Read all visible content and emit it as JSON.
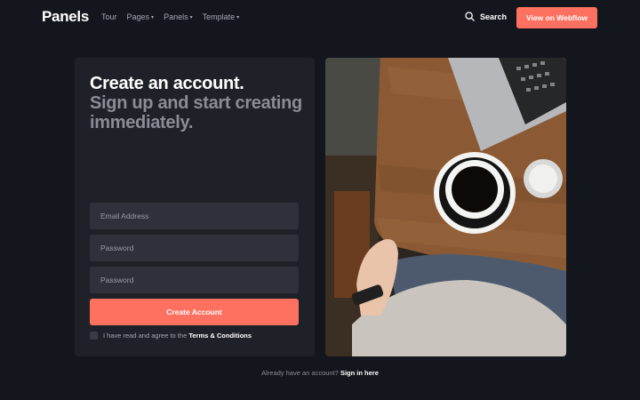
{
  "nav": {
    "brand": "Panels",
    "links": [
      {
        "label": "Tour",
        "has_caret": false
      },
      {
        "label": "Pages",
        "has_caret": true
      },
      {
        "label": "Panels",
        "has_caret": true
      },
      {
        "label": "Template",
        "has_caret": true
      }
    ],
    "caret": "▾",
    "search_label": "Search",
    "search_icon": "search-icon",
    "cta_label": "View on Webflow"
  },
  "form": {
    "title": "Create an account.",
    "subtitle": "Sign up and start creating immediately.",
    "email_placeholder": "Email Address",
    "password_placeholder": "Password",
    "confirm_placeholder": "Password",
    "submit_label": "Create Account",
    "agree_text": "I have read and agree to the",
    "terms_label": "Terms & Conditions"
  },
  "footer": {
    "prompt": "Already have an account?",
    "signin_label": "Sign in here"
  },
  "colors": {
    "background": "#14161d",
    "card": "#1f2129",
    "field": "#2f313a",
    "accent": "#fe7060",
    "muted_text": "#8b8d95"
  }
}
